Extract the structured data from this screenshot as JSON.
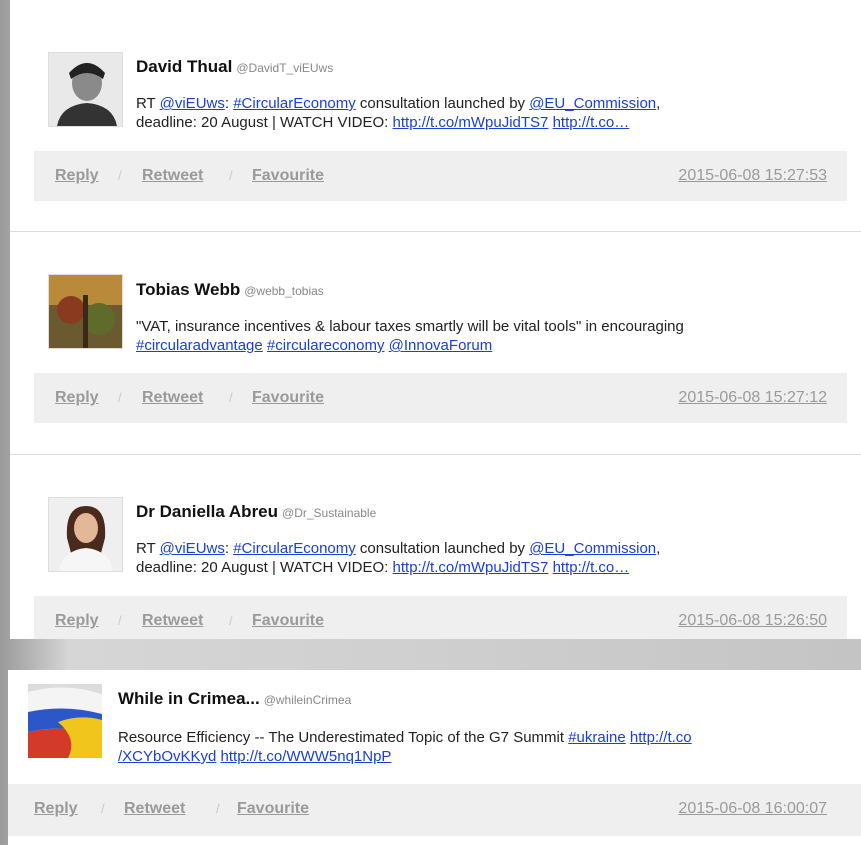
{
  "labels": {
    "reply": "Reply",
    "sep": "/",
    "retweet": "Retweet",
    "favourite": "Favourite"
  },
  "tweets": [
    {
      "name": "David Thual",
      "handle": "@DavidT_viEUws",
      "line1": [
        {
          "t": "RT "
        },
        {
          "t": "@viEUws",
          "link": true
        },
        {
          "t": ": "
        },
        {
          "t": "#CircularEconomy",
          "link": true
        },
        {
          "t": " consultation launched by "
        },
        {
          "t": "@EU_Commission",
          "link": true
        },
        {
          "t": ","
        }
      ],
      "line2": [
        {
          "t": "deadline: 20 August | WATCH VIDEO: "
        },
        {
          "t": "http://t.co/mWpuJidTS7",
          "link": true
        },
        {
          "t": " "
        },
        {
          "t": "http://t.co…",
          "link": true
        }
      ],
      "timestamp": "2015-06-08 15:27:53"
    },
    {
      "name": "Tobias Webb",
      "handle": "@webb_tobias",
      "line1": [
        {
          "t": "\"VAT, insurance incentives & labour taxes smartly will be vital tools\" in encouraging"
        }
      ],
      "line2": [
        {
          "t": "#circularadvantage",
          "link": true
        },
        {
          "t": " "
        },
        {
          "t": "#circulareconomy",
          "link": true
        },
        {
          "t": " "
        },
        {
          "t": "@InnovaForum",
          "link": true
        }
      ],
      "timestamp": "2015-06-08 15:27:12"
    },
    {
      "name": "Dr Daniella Abreu",
      "handle": "@Dr_Sustainable",
      "line1": [
        {
          "t": "RT "
        },
        {
          "t": "@viEUws",
          "link": true
        },
        {
          "t": ": "
        },
        {
          "t": "#CircularEconomy",
          "link": true
        },
        {
          "t": " consultation launched by "
        },
        {
          "t": "@EU_Commission",
          "link": true
        },
        {
          "t": ","
        }
      ],
      "line2": [
        {
          "t": "deadline: 20 August | WATCH VIDEO: "
        },
        {
          "t": "http://t.co/mWpuJidTS7",
          "link": true
        },
        {
          "t": " "
        },
        {
          "t": "http://t.co…",
          "link": true
        }
      ],
      "timestamp": "2015-06-08 15:26:50"
    },
    {
      "name": "While in Crimea...",
      "handle": "@whileinCrimea",
      "line1": [
        {
          "t": "Resource Efficiency -- The Underestimated Topic of the G7 Summit "
        },
        {
          "t": "#ukraine",
          "link": true
        },
        {
          "t": " "
        },
        {
          "t": "http://t.co",
          "link": true
        }
      ],
      "line2": [
        {
          "t": "/XCYbOvKKyd",
          "link": true
        },
        {
          "t": " "
        },
        {
          "t": "http://t.co/WWW5nq1NpP",
          "link": true
        }
      ],
      "timestamp": "2015-06-08 16:00:07"
    }
  ]
}
